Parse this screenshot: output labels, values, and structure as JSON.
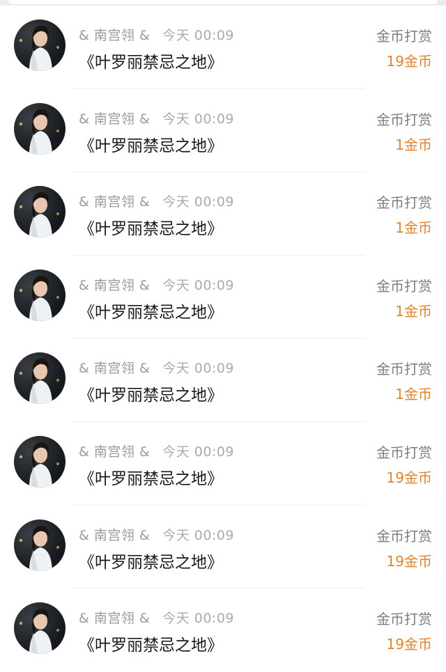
{
  "colors": {
    "amount": "#e0832d",
    "meta_text": "#9a9a9a",
    "title_text": "#1a1a1a",
    "label_text": "#7d7d7d"
  },
  "records": [
    {
      "user": "& 南宫翎 &",
      "time": "今天 00:09",
      "work": "《叶罗丽禁忌之地》",
      "type": "金币打赏",
      "amount": "19金币"
    },
    {
      "user": "& 南宫翎 &",
      "time": "今天 00:09",
      "work": "《叶罗丽禁忌之地》",
      "type": "金币打赏",
      "amount": "1金币"
    },
    {
      "user": "& 南宫翎 &",
      "time": "今天 00:09",
      "work": "《叶罗丽禁忌之地》",
      "type": "金币打赏",
      "amount": "1金币"
    },
    {
      "user": "& 南宫翎 &",
      "time": "今天 00:09",
      "work": "《叶罗丽禁忌之地》",
      "type": "金币打赏",
      "amount": "1金币"
    },
    {
      "user": "& 南宫翎 &",
      "time": "今天 00:09",
      "work": "《叶罗丽禁忌之地》",
      "type": "金币打赏",
      "amount": "1金币"
    },
    {
      "user": "& 南宫翎 &",
      "time": "今天 00:09",
      "work": "《叶罗丽禁忌之地》",
      "type": "金币打赏",
      "amount": "19金币"
    },
    {
      "user": "& 南宫翎 &",
      "time": "今天 00:09",
      "work": "《叶罗丽禁忌之地》",
      "type": "金币打赏",
      "amount": "19金币"
    },
    {
      "user": "& 南宫翎 &",
      "time": "今天 00:09",
      "work": "《叶罗丽禁忌之地》",
      "type": "金币打赏",
      "amount": "19金币"
    }
  ]
}
